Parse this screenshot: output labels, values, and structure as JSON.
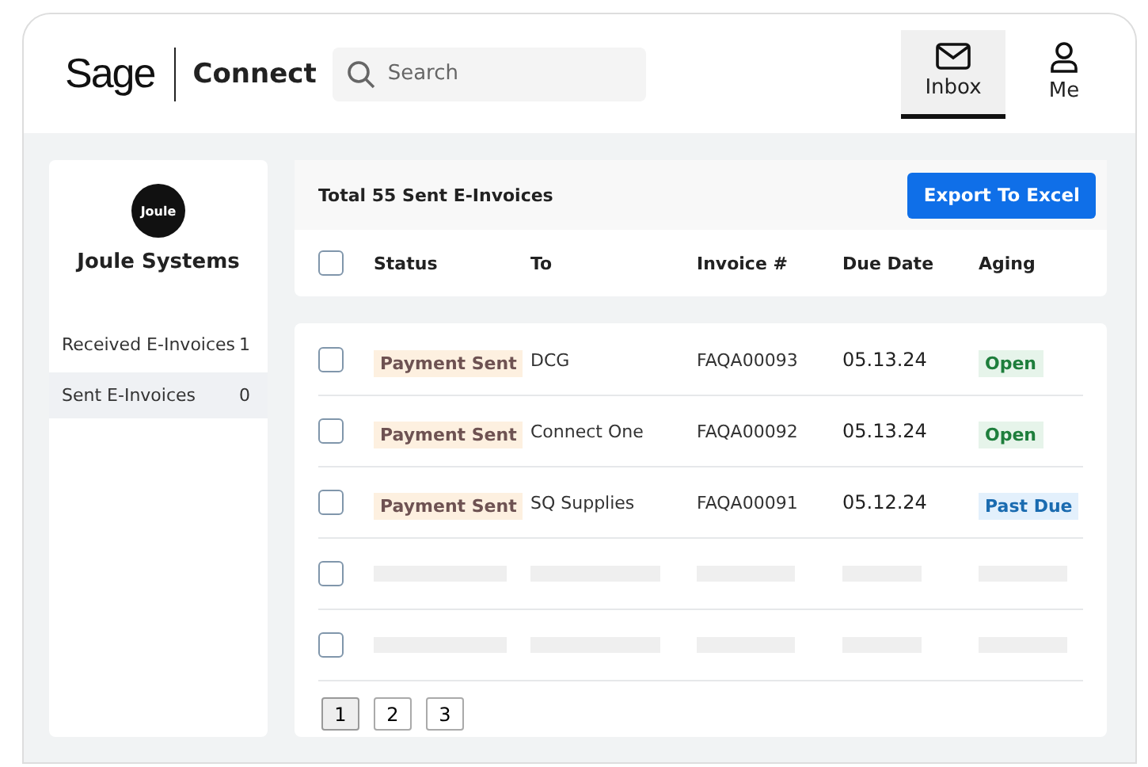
{
  "header": {
    "logo": "Sage",
    "product": "Connect",
    "search": {
      "placeholder": "Search"
    },
    "nav": [
      {
        "label": "Inbox",
        "kind": "mail",
        "selected": true
      },
      {
        "label": "Me",
        "kind": "user",
        "selected": false
      }
    ]
  },
  "sidebar": {
    "avatar": "Joule",
    "company": "Joule Systems",
    "items": [
      {
        "label": "Received E-Invoices",
        "count": "1",
        "selected": false
      },
      {
        "label": "Sent E-Invoices",
        "count": "0",
        "selected": true
      }
    ]
  },
  "toolbar": {
    "title": "Total 55 Sent E-Invoices",
    "export": "Export To Excel"
  },
  "table": {
    "columns": [
      "Status",
      "To",
      "Invoice #",
      "Due Date",
      "Aging"
    ],
    "header_checked": false,
    "rows": [
      {
        "kind": "invoice",
        "checked": false,
        "status": "Payment Sent",
        "to": "DCG",
        "invoice": "FAQA00093",
        "due": "05.13.24",
        "aging": {
          "label": "Open",
          "kind": "open"
        }
      },
      {
        "kind": "invoice",
        "checked": false,
        "status": "Payment Sent",
        "to": "Connect One",
        "invoice": "FAQA00092",
        "due": "05.13.24",
        "aging": {
          "label": "Open",
          "kind": "open"
        }
      },
      {
        "kind": "invoice",
        "checked": false,
        "status": "Payment Sent",
        "to": "SQ Supplies",
        "invoice": "FAQA00091",
        "due": "05.12.24",
        "aging": {
          "label": "Past Due",
          "kind": "past_due"
        }
      },
      {
        "kind": "placeholder",
        "checked": false
      },
      {
        "kind": "placeholder",
        "checked": false
      }
    ]
  },
  "pagination": [
    {
      "label": "1",
      "selected": true
    },
    {
      "label": "2",
      "selected": false
    },
    {
      "label": "3",
      "selected": false
    }
  ]
}
